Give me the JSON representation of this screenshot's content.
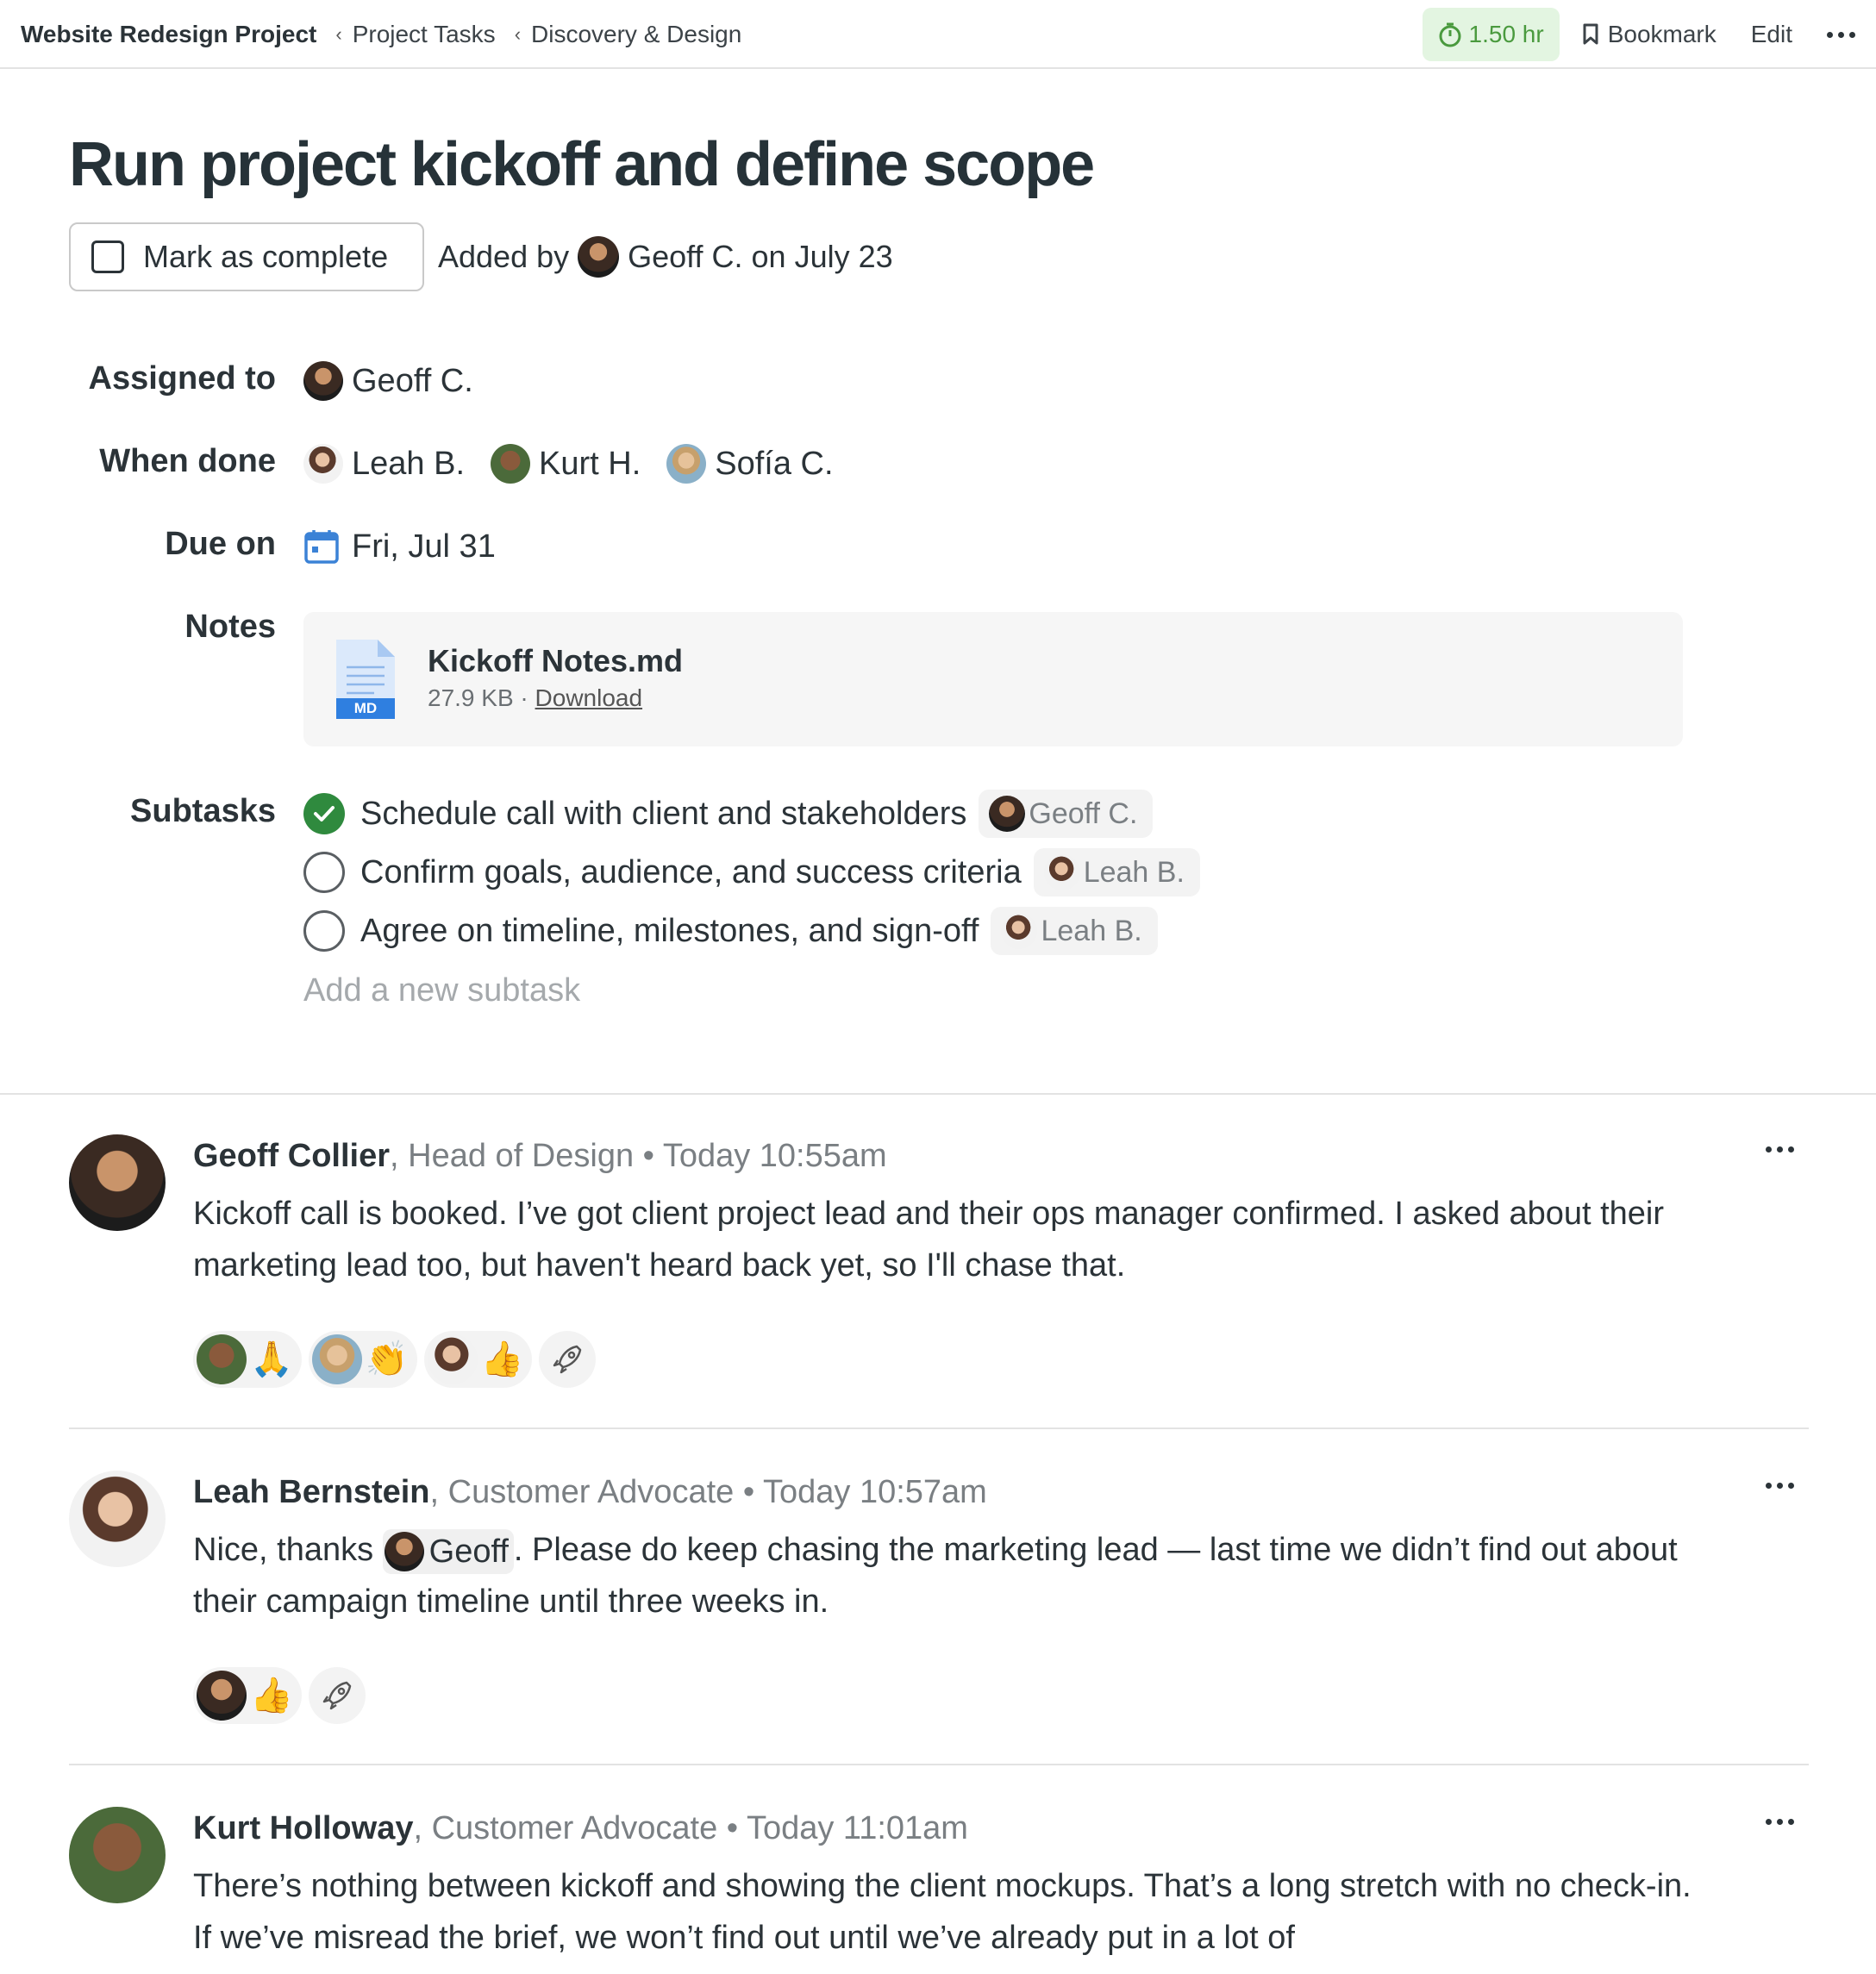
{
  "breadcrumb": {
    "project": "Website Redesign Project",
    "separator": "‹",
    "items": [
      "Project Tasks",
      "Discovery & Design"
    ]
  },
  "toolbar": {
    "timer": "1.50 hr",
    "bookmark": "Bookmark",
    "edit": "Edit"
  },
  "task": {
    "title": "Run project kickoff and define scope",
    "mark_complete": "Mark as complete",
    "added_by_prefix": "Added by",
    "added_by_name": "Geoff C.",
    "added_on": "on July 23"
  },
  "details": {
    "assigned_label": "Assigned to",
    "assigned": "Geoff C.",
    "when_done_label": "When done",
    "when_done": [
      "Leah B.",
      "Kurt H.",
      "Sofía C."
    ],
    "due_label": "Due on",
    "due": "Fri, Jul 31",
    "notes_label": "Notes",
    "file": {
      "name": "Kickoff Notes.md",
      "badge": "MD",
      "size": "27.9 KB",
      "separator": "·",
      "download": "Download"
    },
    "subtasks_label": "Subtasks",
    "subtasks": [
      {
        "text": "Schedule call with client and stakeholders",
        "assignee": "Geoff C.",
        "done": true
      },
      {
        "text": "Confirm goals, audience, and success criteria",
        "assignee": "Leah B.",
        "done": false
      },
      {
        "text": "Agree on timeline, milestones, and sign-off",
        "assignee": "Leah B.",
        "done": false
      }
    ],
    "add_subtask": "Add a new subtask"
  },
  "comments": [
    {
      "author": "Geoff Collier",
      "role": "Head of Design",
      "time": "Today 10:55am",
      "body": "Kickoff call is booked. I’ve got client project lead and their ops manager confirmed. I asked about their marketing lead too, but haven't heard back yet, so I'll chase that.",
      "reactions": [
        "🙏",
        "👏",
        "👍"
      ]
    },
    {
      "author": "Leah Bernstein",
      "role": "Customer Advocate",
      "time": "Today 10:57am",
      "body_before": "Nice, thanks",
      "mention": "Geoff",
      "body_after": ". Please do keep chasing the marketing lead — last time we didn’t find out about their campaign timeline until three weeks in.",
      "reactions": [
        "👍"
      ]
    },
    {
      "author": "Kurt Holloway",
      "role": "Customer Advocate",
      "time": "Today 11:01am",
      "body": "There’s nothing between kickoff and showing the client mockups. That’s a long stretch with no check-in. If we’ve misread the brief, we won’t find out until we’ve already put in a lot of"
    }
  ],
  "colors": {
    "accent_green": "#2f8a3e",
    "timer_bg": "#e3f5e1",
    "calendar_blue": "#3b82d6"
  }
}
